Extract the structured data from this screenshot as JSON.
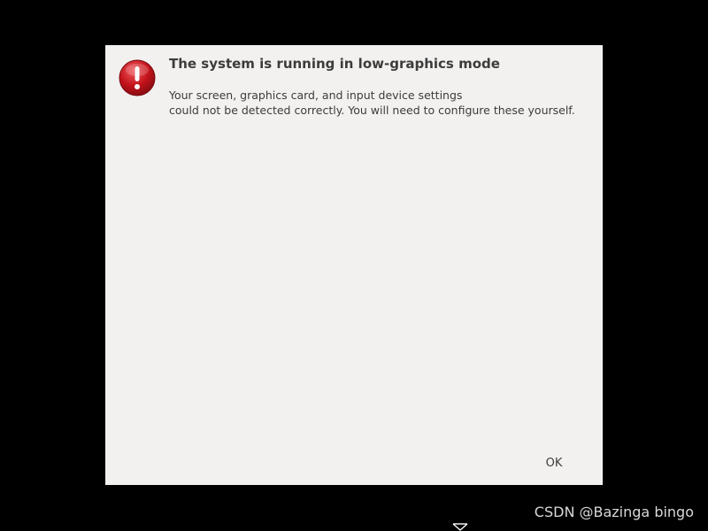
{
  "dialog": {
    "title": "The system is running in low-graphics mode",
    "message_line1": "Your screen, graphics card, and input device settings",
    "message_line2": "could not be detected correctly.  You will need to configure these yourself.",
    "ok_label": "OK",
    "icon": "alert-icon"
  },
  "watermark": {
    "text": "CSDN @Bazinga bingo"
  },
  "colors": {
    "background": "#000000",
    "dialog_bg": "#f2f1f0",
    "text": "#3c3c3c",
    "alert_red": "#c4131b"
  }
}
